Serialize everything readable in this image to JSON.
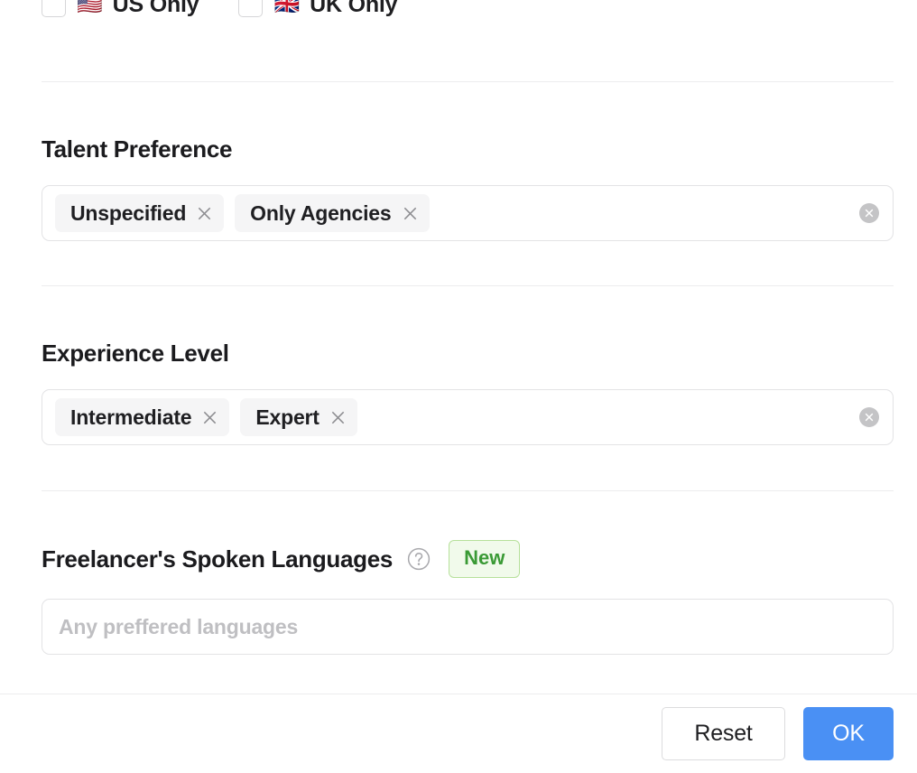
{
  "filters": {
    "location_checkboxes": [
      {
        "label": "US Only",
        "flag": "🇺🇸",
        "flag_name": "us-flag-icon",
        "checked": false
      },
      {
        "label": "UK Only",
        "flag": "🇬🇧",
        "flag_name": "uk-flag-icon",
        "checked": false
      }
    ],
    "sections": [
      {
        "key": "talent_preference",
        "title": "Talent Preference",
        "chips": [
          {
            "label": "Unspecified"
          },
          {
            "label": "Only Agencies"
          }
        ],
        "clear_icon": "close-circle-icon"
      },
      {
        "key": "experience_level",
        "title": "Experience Level",
        "chips": [
          {
            "label": "Intermediate"
          },
          {
            "label": "Expert"
          }
        ],
        "clear_icon": "close-circle-icon"
      },
      {
        "key": "spoken_languages",
        "title": "Freelancer's Spoken Languages",
        "help_icon": "help-circle-icon",
        "badge": "New",
        "value": "",
        "placeholder": "Any preffered languages"
      }
    ]
  },
  "footer": {
    "reset_label": "Reset",
    "ok_label": "OK"
  },
  "colors": {
    "accent_blue": "#4a90f4",
    "badge_green_text": "#3a9a35",
    "badge_green_bg": "#f1faeb",
    "badge_green_border": "#b6e09a",
    "chip_bg": "#f5f5f6",
    "border": "#e3e3e5",
    "divider": "#ececee",
    "placeholder": "#bfbfc2"
  }
}
